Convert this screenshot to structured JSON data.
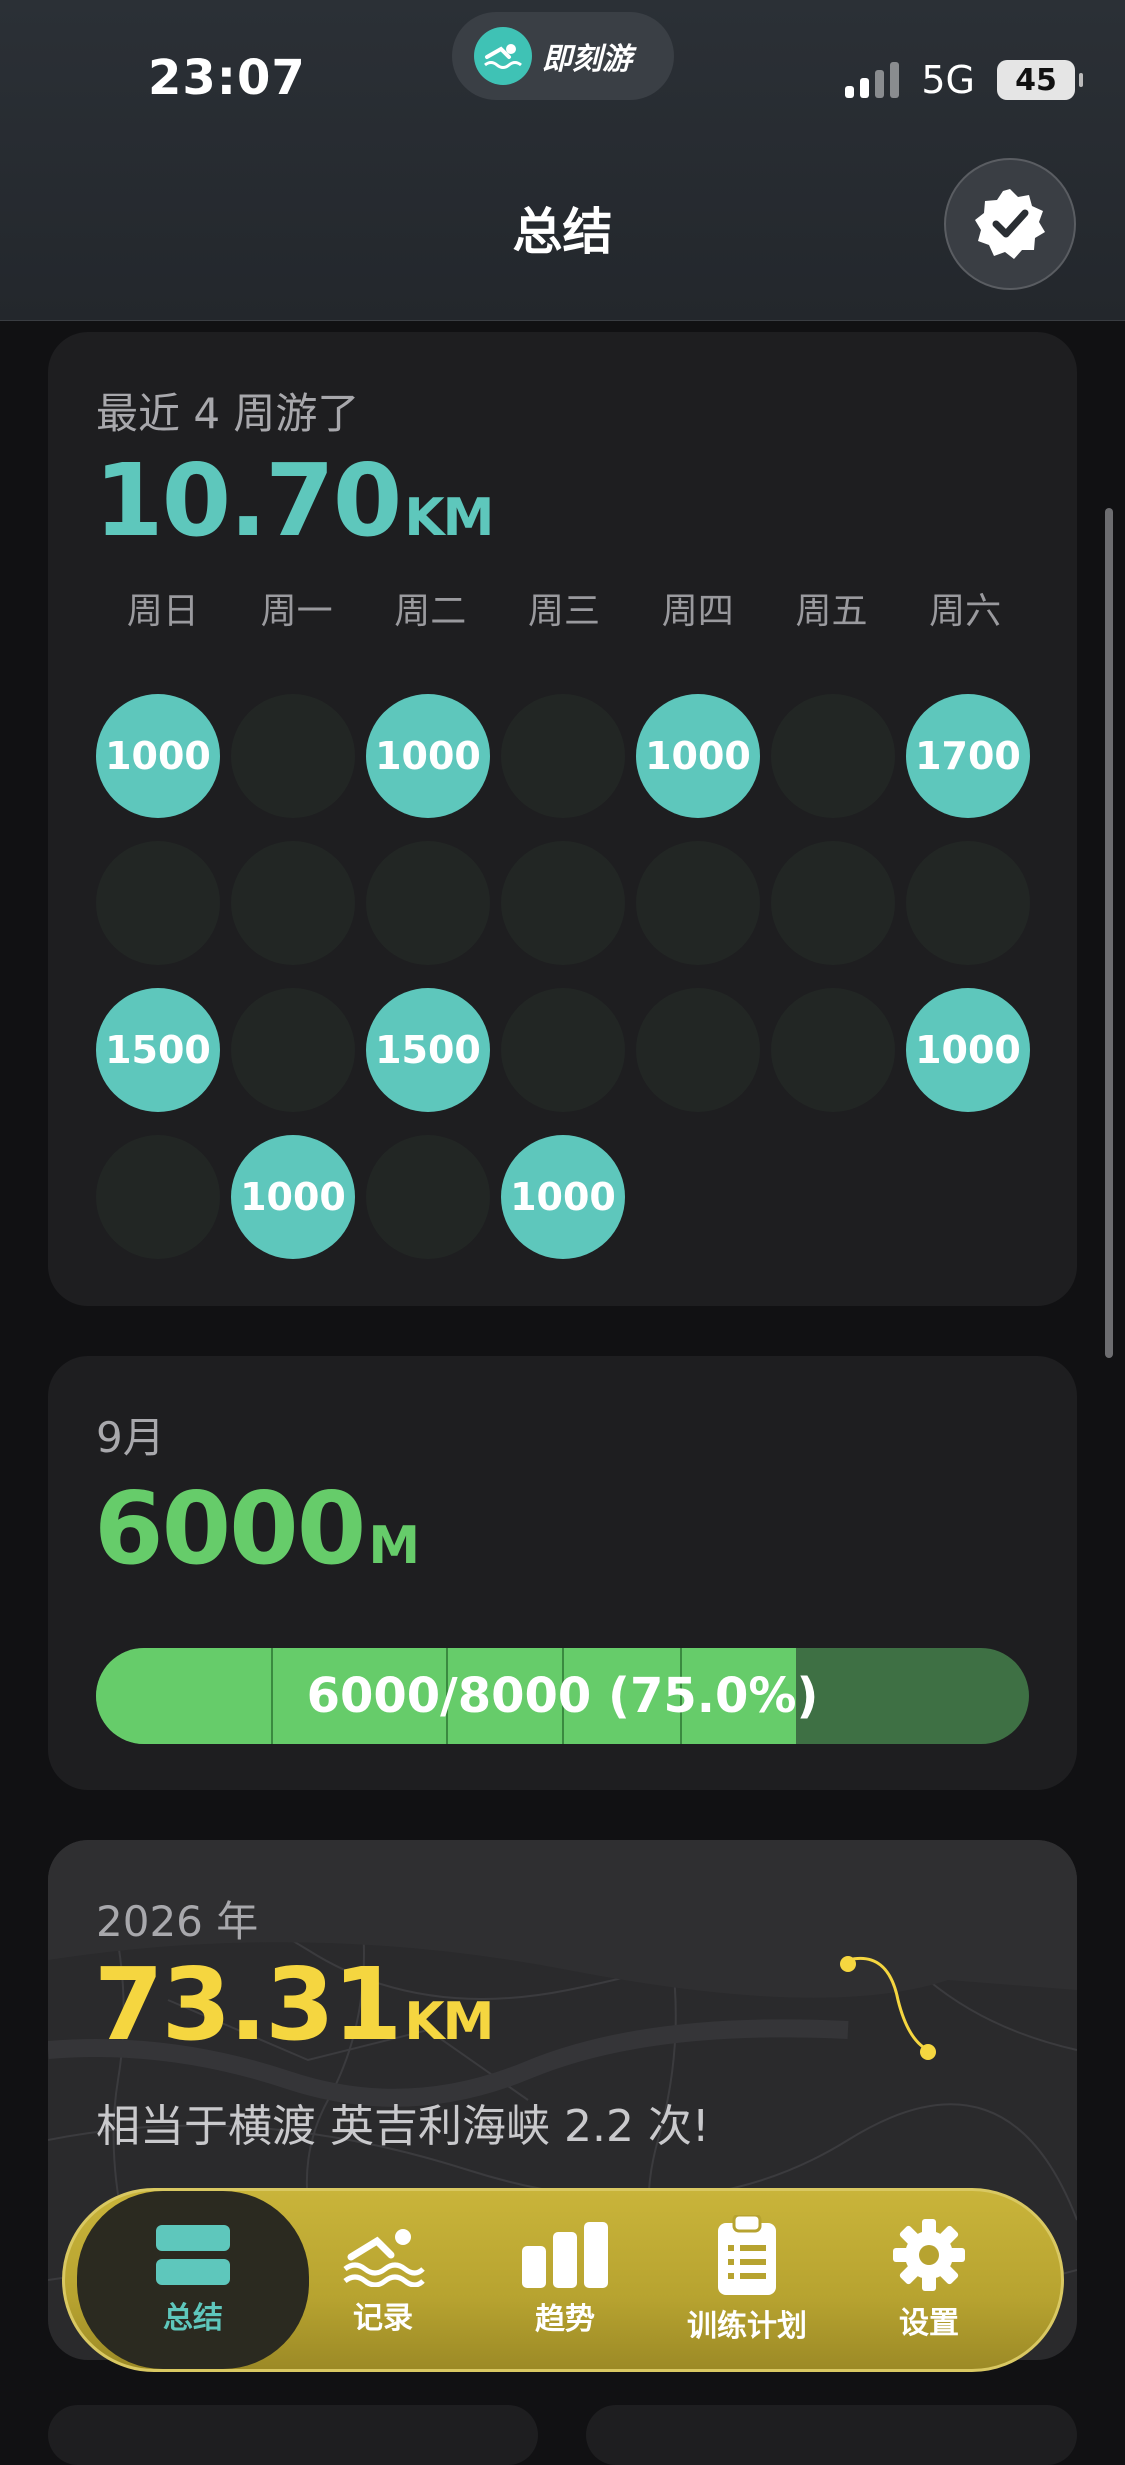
{
  "status_bar": {
    "time": "23:07",
    "network": "5G",
    "battery": "45"
  },
  "app_pill": {
    "brand": "即刻游"
  },
  "header": {
    "title": "总结"
  },
  "weeks_card": {
    "label": "最近 4 周游了",
    "total": "10.70",
    "unit": "KM",
    "weekdays": [
      "周日",
      "周一",
      "周二",
      "周三",
      "周四",
      "周五",
      "周六"
    ],
    "grid": [
      [
        "1000",
        "",
        "1000",
        "",
        "1000",
        "",
        "1700"
      ],
      [
        "",
        "",
        "",
        "",
        "",
        "",
        ""
      ],
      [
        "1500",
        "",
        "1500",
        "",
        "",
        "",
        "1000"
      ],
      [
        "",
        "1000",
        "",
        "1000"
      ]
    ]
  },
  "month_card": {
    "label": "9月",
    "total": "6000",
    "unit": "M",
    "progress_text": "6000/8000 (75.0%)",
    "progress_fraction": 0.75
  },
  "year_card": {
    "label": "2026 年",
    "total": "73.31",
    "unit": "KM",
    "equivalent": "相当于横渡 英吉利海峡 2.2 次!"
  },
  "bottom_nav": [
    {
      "label": "总结",
      "icon": "summary-icon",
      "active": true
    },
    {
      "label": "记录",
      "icon": "swimmer-icon",
      "active": false
    },
    {
      "label": "趋势",
      "icon": "bar-chart-icon",
      "active": false
    },
    {
      "label": "训练计划",
      "icon": "clipboard-icon",
      "active": false
    },
    {
      "label": "设置",
      "icon": "gear-icon",
      "active": false
    }
  ],
  "colors": {
    "teal": "#5ec7bc",
    "green": "#66cc6a",
    "yellow": "#f5d640",
    "card": "#1e1e20",
    "background": "#111113"
  }
}
